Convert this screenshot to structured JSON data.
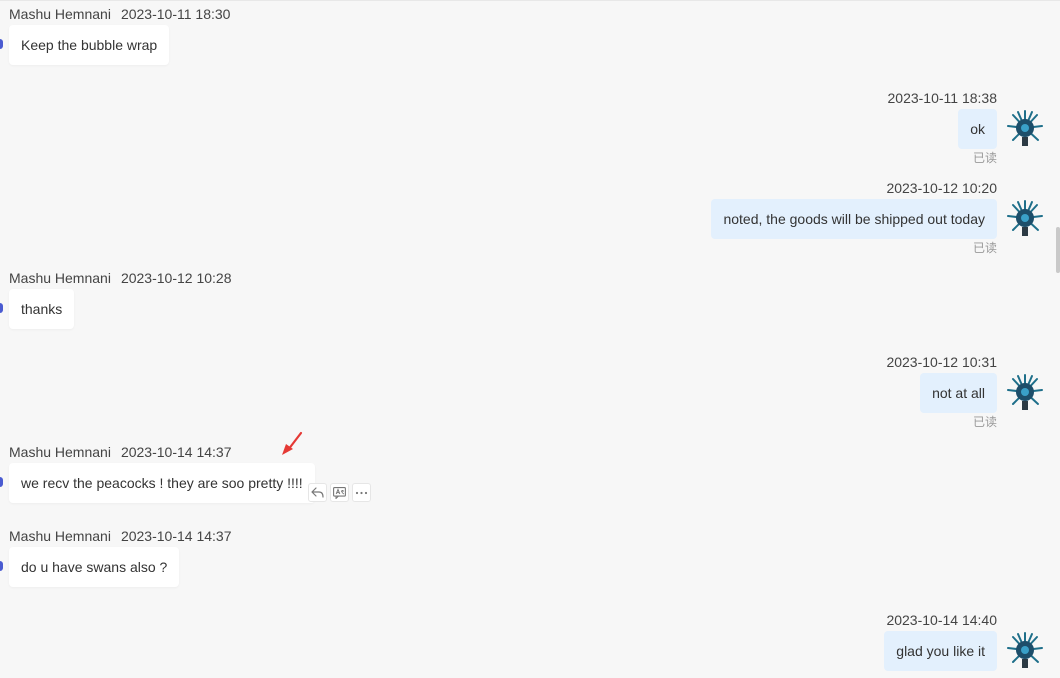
{
  "messages": [
    {
      "sender": "Mashu Hemnani",
      "time": "2023-10-11 18:30",
      "text": "Keep the bubble wrap"
    },
    {
      "time": "2023-10-11 18:38",
      "text": "ok",
      "status": "已读"
    },
    {
      "time": "2023-10-12 10:20",
      "text": "noted, the goods will be shipped out today",
      "status": "已读"
    },
    {
      "sender": "Mashu Hemnani",
      "time": "2023-10-12 10:28",
      "text": "thanks"
    },
    {
      "time": "2023-10-12 10:31",
      "text": "not at all",
      "status": "已读"
    },
    {
      "sender": "Mashu Hemnani",
      "time": "2023-10-14 14:37",
      "text": "we recv the peacocks ! they are soo pretty !!!!"
    },
    {
      "sender": "Mashu Hemnani",
      "time": "2023-10-14 14:37",
      "text": "do u have swans also ?"
    },
    {
      "time": "2023-10-14 14:40",
      "text": "glad you like it"
    }
  ],
  "icons": {
    "reply": "reply-icon",
    "translate": "translate-icon",
    "more": "more-icon",
    "annotation": "red-arrow-icon",
    "avatar": "peacock-feather-avatar"
  },
  "colors": {
    "incoming_bubble": "#ffffff",
    "outgoing_bubble": "#e3f0fd",
    "background": "#f7f7f7",
    "annotation_arrow": "#e53935",
    "incoming_marker": "#4a5bd1"
  }
}
